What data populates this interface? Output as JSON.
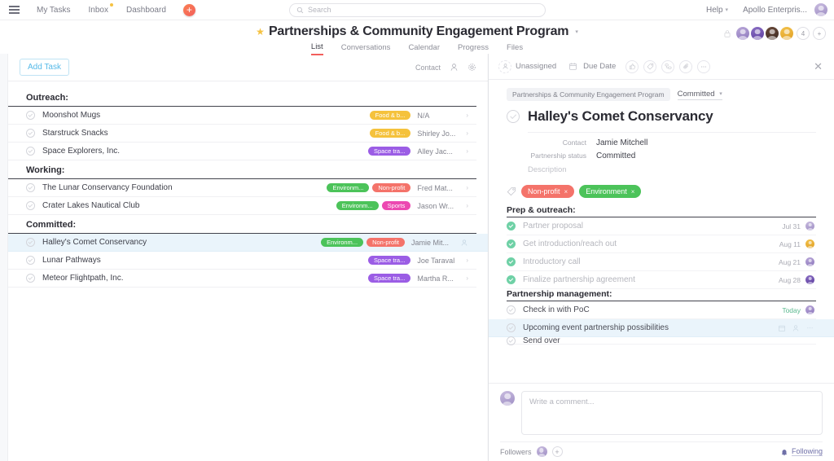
{
  "topnav": {
    "menu_icon": "hamburger-icon",
    "links": [
      {
        "label": "My Tasks",
        "badge": false
      },
      {
        "label": "Inbox",
        "badge": true
      },
      {
        "label": "Dashboard",
        "badge": false
      }
    ],
    "add_button": "+",
    "search": {
      "placeholder": "Search",
      "icon": "search-icon"
    },
    "help_label": "Help",
    "workspace_label": "Apollo Enterpris..."
  },
  "project": {
    "star_icon": "star-icon",
    "title": "Partnerships & Community Engagement Program",
    "title_caret": "chevron-down-icon",
    "tabs": [
      {
        "label": "List",
        "active": true
      },
      {
        "label": "Conversations",
        "active": false
      },
      {
        "label": "Calendar",
        "active": false
      },
      {
        "label": "Progress",
        "active": false
      },
      {
        "label": "Files",
        "active": false
      }
    ],
    "members_overflow": "4",
    "members_add": "+",
    "lock_icon": "lock-icon"
  },
  "list": {
    "add_task_label": "Add Task",
    "contact_label": "Contact",
    "person_icon": "person-icon",
    "settings_icon": "gear-icon",
    "sections": [
      {
        "title": "Outreach:",
        "tasks": [
          {
            "name": "Moonshot Mugs",
            "tags": [
              {
                "label": "Food & b...",
                "color": "#f5c23c"
              }
            ],
            "assignee": "N/A",
            "selected": false
          },
          {
            "name": "Starstruck Snacks",
            "tags": [
              {
                "label": "Food & b...",
                "color": "#f5c23c"
              }
            ],
            "assignee": "Shirley Jo...",
            "selected": false
          },
          {
            "name": "Space Explorers, Inc.",
            "tags": [
              {
                "label": "Space tra...",
                "color": "#9b5de5"
              }
            ],
            "assignee": "Alley Jac...",
            "selected": false
          }
        ]
      },
      {
        "title": "Working:",
        "tasks": [
          {
            "name": "The Lunar Conservancy Foundation",
            "tags": [
              {
                "label": "Environm...",
                "color": "#4cc35a"
              },
              {
                "label": "Non-profit",
                "color": "#f4736a"
              }
            ],
            "assignee": "Fred Mat...",
            "selected": false
          },
          {
            "name": "Crater Lakes Nautical Club",
            "tags": [
              {
                "label": "Environm...",
                "color": "#4cc35a"
              },
              {
                "label": "Sports",
                "color": "#ec49b1"
              }
            ],
            "assignee": "Jason Wr...",
            "selected": false
          }
        ]
      },
      {
        "title": "Committed:",
        "tasks": [
          {
            "name": "Halley's Comet Conservancy",
            "tags": [
              {
                "label": "Environm...",
                "color": "#4cc35a"
              },
              {
                "label": "Non-profit",
                "color": "#f4736a"
              }
            ],
            "assignee": "Jamie Mit...",
            "selected": true
          },
          {
            "name": "Lunar Pathways",
            "tags": [
              {
                "label": "Space tra...",
                "color": "#9b5de5"
              }
            ],
            "assignee": "Joe Taraval",
            "selected": false
          },
          {
            "name": "Meteor Flightpath, Inc.",
            "tags": [
              {
                "label": "Space tra...",
                "color": "#9b5de5"
              }
            ],
            "assignee": "Martha R...",
            "selected": false
          }
        ]
      }
    ]
  },
  "detail": {
    "toolbar": {
      "assignee_label": "Unassigned",
      "assignee_icon": "person-icon",
      "due_date_label": "Due Date",
      "due_date_icon": "calendar-icon",
      "actions": [
        "like-icon",
        "tag-icon",
        "subtask-icon",
        "attachment-icon",
        "more-icon"
      ],
      "close_icon": "close-icon"
    },
    "breadcrumb_project": "Partnerships & Community Engagement Program",
    "breadcrumb_status": "Committed",
    "breadcrumb_status_caret": "chevron-down-icon",
    "title": "Halley's Comet Conservancy",
    "fields": [
      {
        "label": "Contact",
        "value": "Jamie Mitchell"
      },
      {
        "label": "Partnership status",
        "value": "Committed"
      }
    ],
    "description_placeholder": "Description",
    "tag_icon": "tag-icon",
    "tags": [
      {
        "label": "Non-profit",
        "color": "#f4736a",
        "remove": "×"
      },
      {
        "label": "Environment",
        "color": "#4cc35a",
        "remove": "×"
      }
    ],
    "subtask_groups": [
      {
        "title": "Prep & outreach:",
        "items": [
          {
            "name": "Partner proposal",
            "done": true,
            "date": "Jul 31",
            "avatar": "av-e",
            "highlight": false
          },
          {
            "name": "Get introduction/reach out",
            "done": true,
            "date": "Aug 11",
            "avatar": "av-d",
            "highlight": false
          },
          {
            "name": "Introductory call",
            "done": true,
            "date": "Aug 21",
            "avatar": "av-a",
            "highlight": false
          },
          {
            "name": "Finalize partnership agreement",
            "done": true,
            "date": "Aug 28",
            "avatar": "av-b",
            "highlight": false
          }
        ]
      },
      {
        "title": "Partnership management:",
        "items": [
          {
            "name": "Check in with PoC",
            "done": false,
            "date": "Today",
            "today": true,
            "avatar": "av-a",
            "highlight": false
          },
          {
            "name": "Upcoming event partnership possibilities",
            "done": false,
            "date": "",
            "avatar": "",
            "highlight": true,
            "hover_icons": [
              "calendar-icon",
              "person-icon",
              "more-icon"
            ]
          },
          {
            "name": "Send over",
            "done": false,
            "date": "",
            "avatar": "",
            "highlight": false,
            "clipped": true
          }
        ]
      }
    ],
    "comment_placeholder": "Write a comment...",
    "followers_label": "Followers",
    "followers_add": "+",
    "following_label": "Following",
    "bell_icon": "bell-icon"
  }
}
